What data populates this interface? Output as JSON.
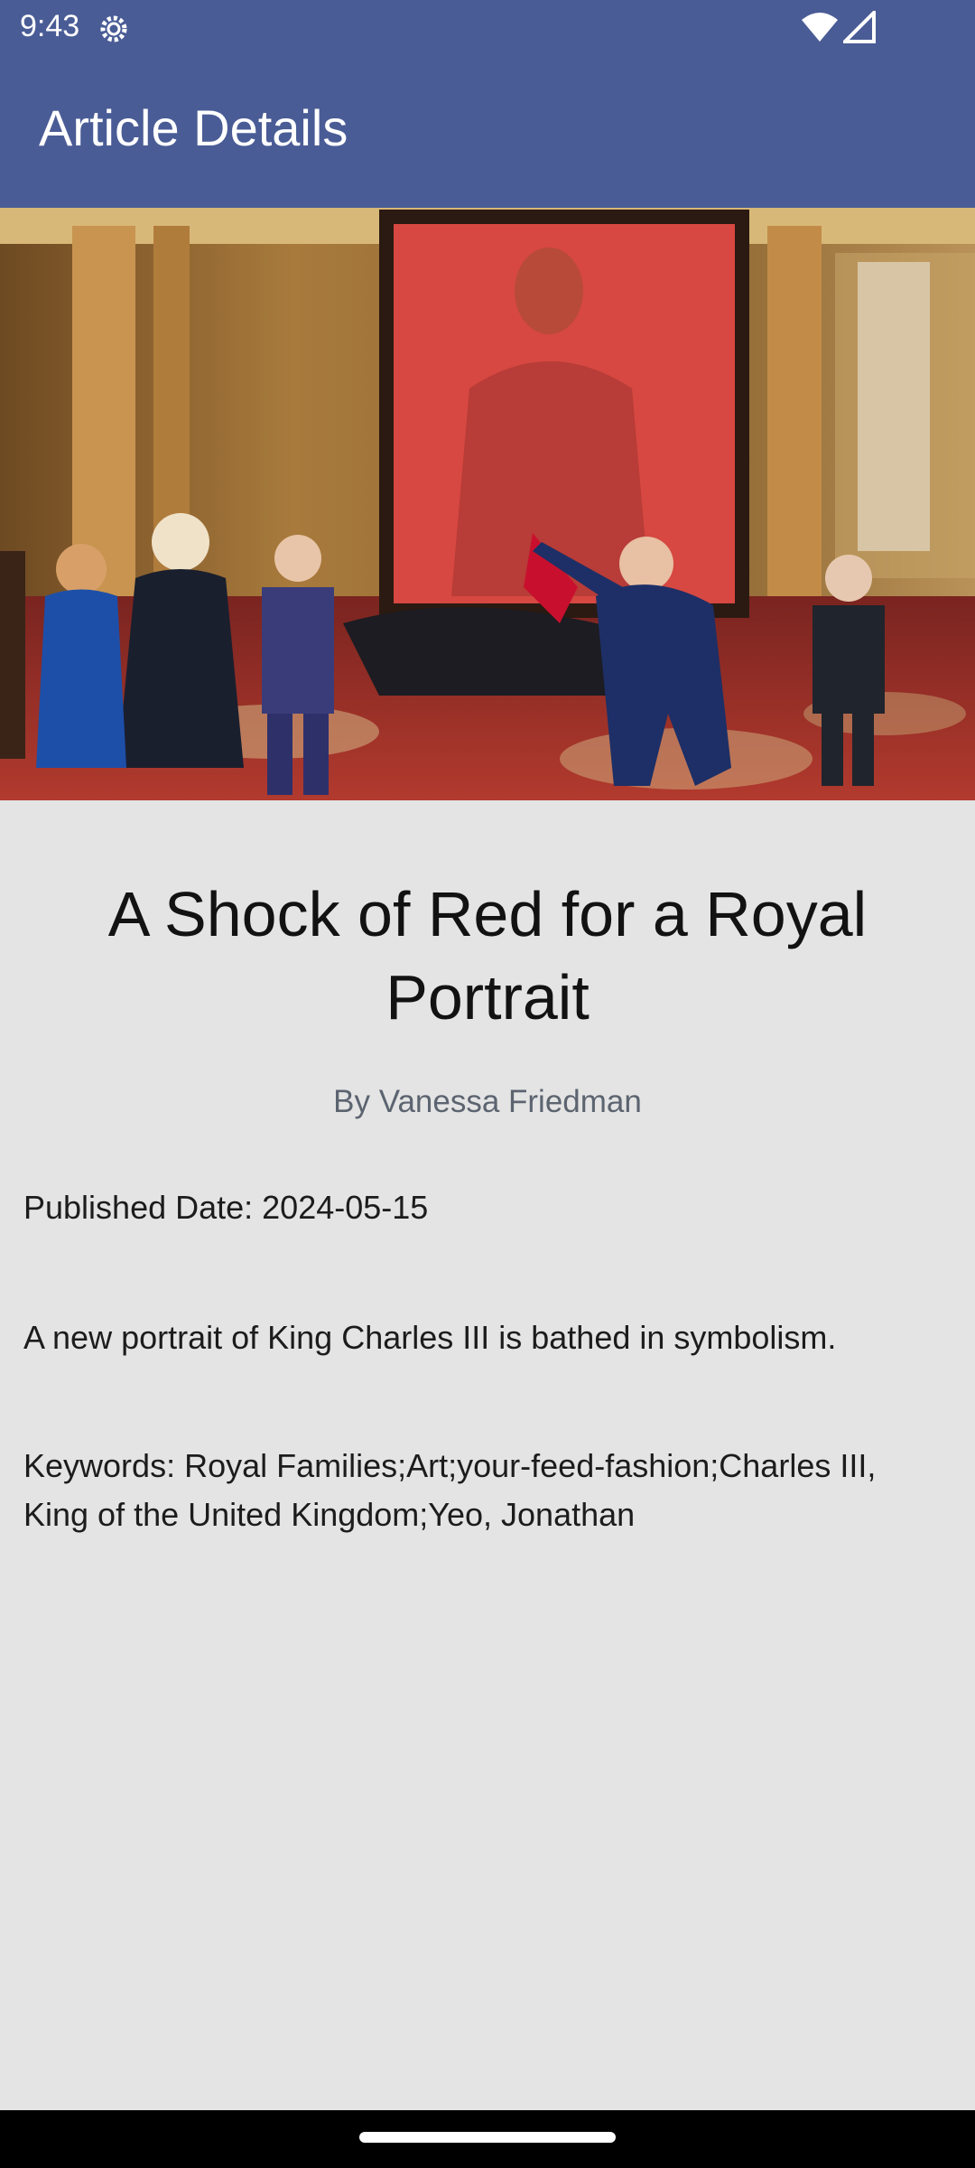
{
  "status_bar": {
    "time": "9:43"
  },
  "app_bar": {
    "title": "Article Details"
  },
  "article": {
    "title": "A Shock of Red for a Royal Portrait",
    "byline": "By Vanessa Friedman",
    "published": "Published Date: 2024-05-15",
    "abstract": "A new portrait of King Charles III is bathed in symbolism.",
    "keywords": "Keywords: Royal Families;Art;your-feed-fashion;Charles III, King of the United Kingdom;Yeo, Jonathan"
  },
  "colors": {
    "primary": "#4a5c96",
    "background": "#e4e4e4",
    "byline": "#5c6470"
  }
}
